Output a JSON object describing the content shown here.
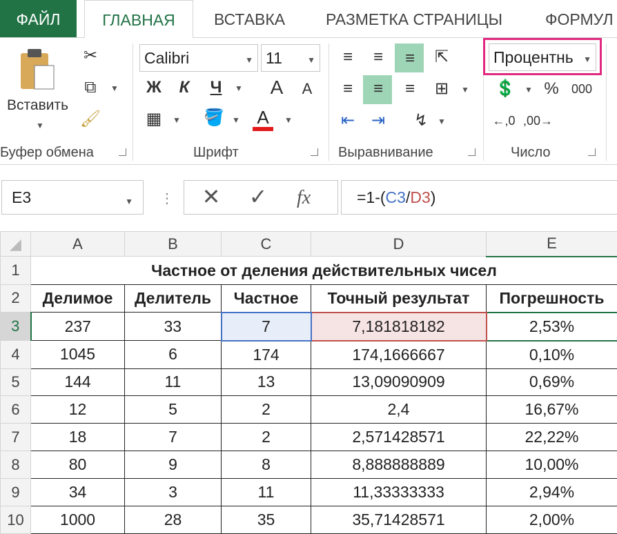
{
  "tabs": {
    "file": "ФАЙЛ",
    "home": "ГЛАВНАЯ",
    "insert": "ВСТАВКА",
    "layout": "РАЗМЕТКА СТРАНИЦЫ",
    "formulas": "ФОРМУЛ"
  },
  "ribbon": {
    "clipboard": {
      "paste_label": "Вставить",
      "group_label": "Буфер обмена"
    },
    "font": {
      "font_name": "Calibri",
      "font_size": "11",
      "bold": "Ж",
      "italic": "К",
      "underline": "Ч",
      "grow": "A",
      "shrink": "A",
      "color_a": "A",
      "group_label": "Шрифт"
    },
    "alignment": {
      "group_label": "Выравнивание"
    },
    "number": {
      "format": "Процентнь",
      "percent": "%",
      "thousands": "000",
      "group_label": "Число"
    }
  },
  "formula_bar": {
    "name_box": "E3",
    "fx": "fx",
    "formula_prefix": "=1-(",
    "ref1": "C3",
    "slash": "/",
    "ref2": "D3",
    "formula_suffix": ")"
  },
  "sheet": {
    "columns": [
      "A",
      "B",
      "C",
      "D",
      "E"
    ],
    "title": "Частное от деления действительных чисел",
    "headers": [
      "Делимое",
      "Делитель",
      "Частное",
      "Точный результат",
      "Погрешность"
    ],
    "rows": [
      [
        "237",
        "33",
        "7",
        "7,181818182",
        "2,53%"
      ],
      [
        "1045",
        "6",
        "174",
        "174,1666667",
        "0,10%"
      ],
      [
        "144",
        "11",
        "13",
        "13,09090909",
        "0,69%"
      ],
      [
        "12",
        "5",
        "2",
        "2,4",
        "16,67%"
      ],
      [
        "18",
        "7",
        "2",
        "2,571428571",
        "22,22%"
      ],
      [
        "80",
        "9",
        "8",
        "8,888888889",
        "10,00%"
      ],
      [
        "34",
        "3",
        "11",
        "11,33333333",
        "2,94%"
      ],
      [
        "1000",
        "28",
        "35",
        "35,71428571",
        "2,00%"
      ]
    ],
    "row_numbers": [
      "1",
      "2",
      "3",
      "4",
      "5",
      "6",
      "7",
      "8",
      "9",
      "10"
    ],
    "selected_cell": "E3"
  },
  "colors": {
    "accent": "#217346",
    "ref1": "#4472c4",
    "ref2": "#c0504d",
    "highlight": "#9fd5b7",
    "format_box": "#e0287f"
  }
}
